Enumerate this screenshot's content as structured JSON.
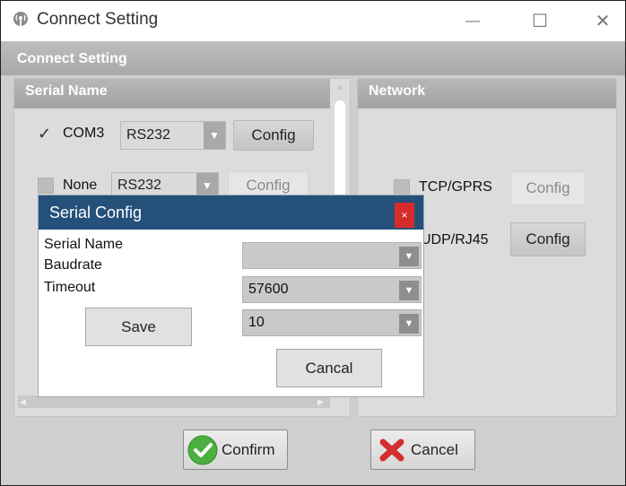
{
  "window": {
    "title": "Connect Setting",
    "controls": {
      "minimize": "—",
      "maximize": "☐",
      "close": "✕"
    }
  },
  "client": {
    "header": "Connect Setting"
  },
  "serial_group": {
    "header": "Serial Name",
    "rows": [
      {
        "checked": true,
        "port": "COM3",
        "type": "RS232",
        "config_label": "Config"
      },
      {
        "checked": false,
        "port": "None",
        "type": "RS232",
        "config_label": "Config"
      }
    ]
  },
  "network_group": {
    "header": "Network",
    "rows": [
      {
        "checked": false,
        "name": "TCP/GPRS",
        "config_label": "Config",
        "enabled": false
      },
      {
        "checked": false,
        "name": "UDP/RJ45",
        "config_label": "Config",
        "enabled": true
      }
    ]
  },
  "footer": {
    "confirm_label": "Confirm",
    "cancel_label": "Cancel"
  },
  "dialog": {
    "title": "Serial Config",
    "close_glyph": "×",
    "labels": {
      "serial_name": "Serial Name",
      "baudrate": "Baudrate",
      "timeout": "Timeout"
    },
    "serial_name_value": "",
    "baudrate_value": "57600",
    "timeout_value": "10",
    "save_label": "Save",
    "cancel_label": "Cancal"
  },
  "colors": {
    "dialog_title_bg": "#25507a",
    "dialog_close_bg": "#d62b2b",
    "confirm_icon": "#4caf3f",
    "cancel_icon": "#d32f2f"
  }
}
